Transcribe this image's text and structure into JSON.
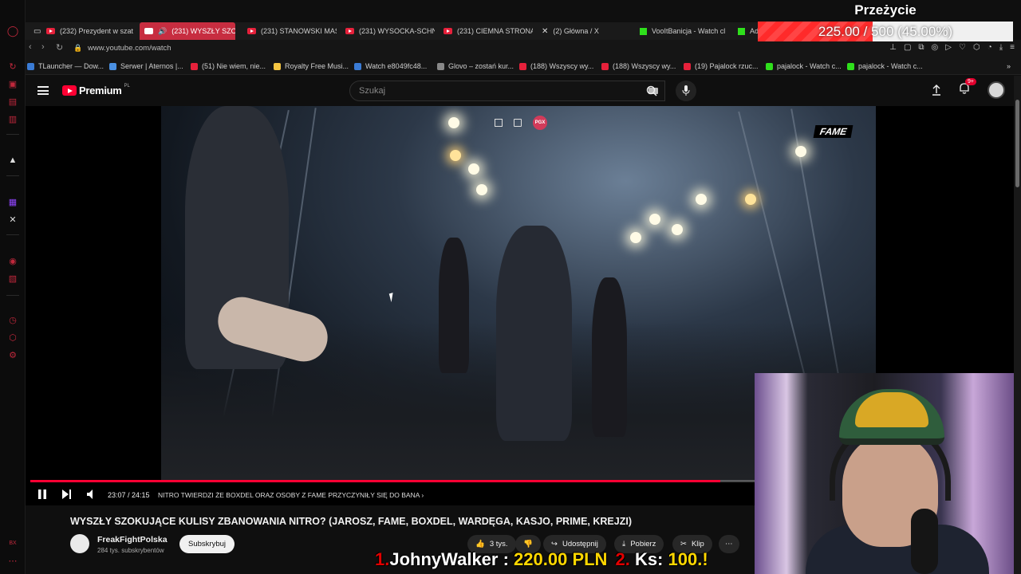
{
  "browser": {
    "tabs": [
      {
        "label": "(232) Prezydent w szat",
        "icon": "youtube-icon"
      },
      {
        "label": "(231) WYSZŁY SZOKI",
        "icon": "youtube-icon",
        "active": true
      },
      {
        "label": "(231) STANOWSKI MAS",
        "icon": "youtube-icon"
      },
      {
        "label": "(231) WYSOCKA-SCHN",
        "icon": "youtube-icon"
      },
      {
        "label": "(231) CIEMNA STRONA",
        "icon": "youtube-icon"
      },
      {
        "label": "(2) Główna / X",
        "icon": "x-icon"
      },
      {
        "label": "VooItBanicja - Watch cl",
        "icon": "kick-icon"
      },
      {
        "label": "Ad",
        "icon": "kick-icon"
      }
    ],
    "url": "www.youtube.com/watch",
    "bookmarks": [
      {
        "label": "TLauncher — Dow...",
        "color": "#3a7bd5"
      },
      {
        "label": "Serwer | Aternos |...",
        "color": "#4a90e2"
      },
      {
        "label": "(51) Nie wiem, nie...",
        "color": "#e6213b"
      },
      {
        "label": "Royalty Free Musi...",
        "color": "#f5c542"
      },
      {
        "label": "Watch e8049fc48...",
        "color": "#3a7bd5"
      },
      {
        "label": "Glovo – zostań kur...",
        "color": "#888888"
      },
      {
        "label": "(188) Wszyscy wy...",
        "color": "#e6213b"
      },
      {
        "label": "(188) Wszyscy wy...",
        "color": "#e6213b"
      },
      {
        "label": "(19) Pajalock rzuc...",
        "color": "#e6213b"
      },
      {
        "label": "pajalock - Watch c...",
        "color": "#2fe01c"
      },
      {
        "label": "pajalock - Watch c...",
        "color": "#2fe01c"
      }
    ]
  },
  "youtube": {
    "logo_text": "Premium",
    "logo_region": "PL",
    "search_placeholder": "Szukaj",
    "notification_count": "9+"
  },
  "video": {
    "overlay_logo": "FAME",
    "pgx_badge": "PGX",
    "current_time": "23:07",
    "duration": "24:15",
    "time_display": "23:07 / 24:15",
    "progress_fraction": 0.953,
    "chapter": "NITRO TWIERDZI ŻE BOXDEL ORAZ OSOBY Z FAME PRZYCZYNIŁY SIĘ DO BANA",
    "title": "WYSZŁY SZOKUJĄCE KULISY ZBANOWANIA NITRO? (JAROSZ, FAME, BOXDEL, WARDĘGA, KASJO, PRIME, KREJZI)",
    "channel": "FreakFightPolska",
    "subscribers": "284 tys. subskrybentów",
    "subscribe_label": "Subskrybuj",
    "likes": "3 tys.",
    "share_label": "Udostępnij",
    "download_label": "Pobierz",
    "clip_label": "Klip"
  },
  "stream": {
    "goal_title": "Przeżycie",
    "goal_text": "225.00 / 500 (45.00%)",
    "goal_fraction": 0.45,
    "ticker": [
      {
        "rank": "1.",
        "name": "JohnyWalker :",
        "amount": "220.00 PLN"
      },
      {
        "rank": "2.",
        "name": "Ks:",
        "amount": "100.!"
      }
    ]
  }
}
